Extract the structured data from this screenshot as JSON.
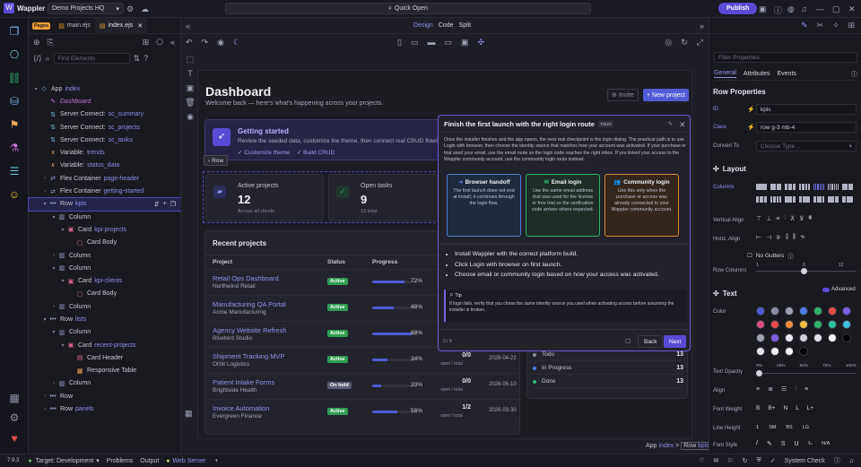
{
  "topbar": {
    "app_name": "Wappler",
    "project": "Demo Projects HQ",
    "quick_open": "Quick Open",
    "publish": "Publish"
  },
  "files": {
    "pages_badge": "Pages",
    "tabs": [
      {
        "label": "main.ejs"
      },
      {
        "label": "index.ejs"
      }
    ],
    "search_placeholder": "Find Elements"
  },
  "tree": [
    {
      "label": "App",
      "sub": "index",
      "indent": 0,
      "caret": "▾",
      "icon": "◇",
      "color": "#7fb8f0"
    },
    {
      "label": "Dashboard",
      "sub": "",
      "indent": 1,
      "caret": "",
      "icon": "✎",
      "color": "#c777d8",
      "italic": true
    },
    {
      "label": "Server Connect:",
      "sub": "sc_summary",
      "indent": 1,
      "caret": "",
      "icon": "⇅",
      "color": "#6ec0d8"
    },
    {
      "label": "Server Connect:",
      "sub": "sc_projects",
      "indent": 1,
      "caret": "",
      "icon": "⇅",
      "color": "#6ec0d8"
    },
    {
      "label": "Server Connect:",
      "sub": "sc_tasks",
      "indent": 1,
      "caret": "",
      "icon": "⇅",
      "color": "#6ec0d8"
    },
    {
      "label": "Variable:",
      "sub": "trends",
      "indent": 1,
      "caret": "",
      "icon": "𝑥",
      "color": "#f0a65a"
    },
    {
      "label": "Variable:",
      "sub": "status_data",
      "indent": 1,
      "caret": "",
      "icon": "𝑥",
      "color": "#f0a65a"
    },
    {
      "label": "Flex Container",
      "sub": "page-header",
      "indent": 1,
      "caret": "›",
      "icon": "⇄",
      "color": "#8fa3d8"
    },
    {
      "label": "Flex Container",
      "sub": "getting-started",
      "indent": 1,
      "caret": "›",
      "icon": "⇄",
      "color": "#8fa3d8"
    },
    {
      "label": "Row",
      "sub": "kpis",
      "indent": 1,
      "caret": "▾",
      "icon": "•••",
      "color": "#9aa0c8",
      "selected": true
    },
    {
      "label": "Column",
      "sub": "",
      "indent": 2,
      "caret": "▾",
      "icon": "▥",
      "color": "#9aa0c8"
    },
    {
      "label": "Card",
      "sub": "kpi-projects",
      "indent": 3,
      "caret": "▾",
      "icon": "▣",
      "color": "#d86a8a"
    },
    {
      "label": "Card Body",
      "sub": "",
      "indent": 4,
      "caret": "",
      "icon": "▢",
      "color": "#d86a8a"
    },
    {
      "label": "Column",
      "sub": "",
      "indent": 2,
      "caret": "›",
      "icon": "▥",
      "color": "#9aa0c8"
    },
    {
      "label": "Column",
      "sub": "",
      "indent": 2,
      "caret": "▾",
      "icon": "▥",
      "color": "#9aa0c8"
    },
    {
      "label": "Card",
      "sub": "kpi-clients",
      "indent": 3,
      "caret": "▾",
      "icon": "▣",
      "color": "#d86a8a"
    },
    {
      "label": "Card Body",
      "sub": "",
      "indent": 4,
      "caret": "",
      "icon": "▢",
      "color": "#d86a8a"
    },
    {
      "label": "Column",
      "sub": "",
      "indent": 2,
      "caret": "›",
      "icon": "▥",
      "color": "#9aa0c8"
    },
    {
      "label": "Row",
      "sub": "lists",
      "indent": 1,
      "caret": "▾",
      "icon": "•••",
      "color": "#9aa0c8"
    },
    {
      "label": "Column",
      "sub": "",
      "indent": 2,
      "caret": "▾",
      "icon": "▥",
      "color": "#9aa0c8"
    },
    {
      "label": "Card",
      "sub": "recent-projects",
      "indent": 3,
      "caret": "▾",
      "icon": "▣",
      "color": "#d86a8a"
    },
    {
      "label": "Card Header",
      "sub": "",
      "indent": 4,
      "caret": "",
      "icon": "▤",
      "color": "#d86a8a"
    },
    {
      "label": "Responsive Table",
      "sub": "",
      "indent": 4,
      "caret": "",
      "icon": "▦",
      "color": "#f0a65a"
    },
    {
      "label": "Column",
      "sub": "",
      "indent": 2,
      "caret": "›",
      "icon": "▥",
      "color": "#9aa0c8"
    },
    {
      "label": "Row",
      "sub": "",
      "indent": 1,
      "caret": "›",
      "icon": "•••",
      "color": "#9aa0c8"
    },
    {
      "label": "Row",
      "sub": "panels",
      "indent": 1,
      "caret": "›",
      "icon": "•••",
      "color": "#9aa0c8"
    }
  ],
  "view": {
    "modes": [
      "Design",
      "Code",
      "Split"
    ]
  },
  "page": {
    "title": "Dashboard",
    "subtitle": "Welcome back — here's what's happening across your projects.",
    "invite": "Invite",
    "new_project": "+ New project",
    "getting_started": {
      "title": "Getting started",
      "text": "Review the seeded data, customize the theme, then connect real CRUD flows.",
      "link1": "Customize theme",
      "link2": "Build CRUD"
    },
    "row_badge": "Row",
    "kpis": [
      {
        "label": "Active projects",
        "value": "12",
        "note": "Across all clients"
      },
      {
        "label": "Open tasks",
        "value": "9",
        "note": "13 total"
      }
    ],
    "recent": {
      "title": "Recent projects",
      "headers": [
        "Project",
        "Status",
        "Progress"
      ],
      "rows": [
        {
          "name": "Retail Ops Dashboard",
          "client": "Northwind Retail",
          "status": "Active",
          "progress": 72,
          "pct": "72%",
          "tasks": "",
          "sub": "",
          "date": ""
        },
        {
          "name": "Manufacturing QA Portal",
          "client": "Acme Manufacturing",
          "status": "Active",
          "progress": 48,
          "pct": "48%",
          "tasks": "",
          "sub": "",
          "date": ""
        },
        {
          "name": "Agency Website Refresh",
          "client": "Bluebird Studio",
          "status": "Active",
          "progress": 88,
          "pct": "88%",
          "tasks": "",
          "sub": "",
          "date": ""
        },
        {
          "name": "Shipment Tracking MVP",
          "client": "Orbit Logistics",
          "status": "Active",
          "progress": 34,
          "pct": "34%",
          "tasks": "0/0",
          "sub": "open / total",
          "date": "2026-04-22"
        },
        {
          "name": "Patient Intake Forms",
          "client": "Brightside Health",
          "status": "On hold",
          "progress": 20,
          "pct": "20%",
          "tasks": "0/0",
          "sub": "open / total",
          "date": "2026-05-10"
        },
        {
          "name": "Invoice Automation",
          "client": "Evergreen Finance",
          "status": "Active",
          "progress": 56,
          "pct": "56%",
          "tasks": "1/2",
          "sub": "open / total",
          "date": "2026-03-30"
        }
      ]
    },
    "task_status": [
      {
        "label": "Todo",
        "count": "13",
        "color": "#8b8fa3"
      },
      {
        "label": "In Progress",
        "count": "13",
        "color": "#4f7ee8"
      },
      {
        "label": "Done",
        "count": "13",
        "color": "#2fb36a"
      }
    ],
    "breadcrumb": {
      "app": "App",
      "app_sub": "index",
      "sep": ">",
      "row": "Row",
      "row_sub": "kpis"
    }
  },
  "tour": {
    "title": "Finish the first launch with the right login route",
    "badge": "TOUR",
    "intro": "Once the installer finishes and the app opens, the next real checkpoint is the login dialog. The practical path is to use Login with browser, then choose the identity source that matches how your account was activated. If your purchase or trial used your email, use the email route so the login code reaches the right inbox. If you linked your access to the Wappler community account, use the community login route instead.",
    "options": [
      {
        "title": "Browser handoff",
        "text": "The first launch does not end at install; it continues through the login flow.",
        "color": "#4d7fd8",
        "bg": "#1e2a3e",
        "icon": "⇥"
      },
      {
        "title": "Email login",
        "text": "Use the same email address that was used for the license or free trial so the verification code arrives where expected.",
        "color": "#2fb36a",
        "bg": "#1c2e26",
        "icon": "✉"
      },
      {
        "title": "Community login",
        "text": "Use this only when the purchase or access was already connected to your Wappler community account.",
        "color": "#d88a3a",
        "bg": "#33261c",
        "icon": "👥"
      }
    ],
    "steps": [
      "Install Wappler with the correct platform build.",
      "Click Login with browser on first launch.",
      "Choose email or community login based on how your access was activated."
    ],
    "tip_label": "Tip",
    "tip": "If login fails, verify that you chose the same identity source you used when activating access before assuming the installer is broken.",
    "counter": "3 / 4",
    "back": "Back",
    "next": "Next"
  },
  "right": {
    "search_placeholder": "Filter Properties",
    "tabs": [
      "General",
      "Attributes",
      "Events"
    ],
    "row_props": "Row Properties",
    "id_label": "ID",
    "id": "kpis",
    "class_label": "Class",
    "class": "row g-3 mb-4",
    "convert_label": "Convert To",
    "convert_placeholder": "Choose Type ..",
    "layout": "Layout",
    "columns_label": "Columns",
    "valign": "Vertical Align",
    "halign": "Horiz. Align",
    "no_gutters": "No Gutters",
    "row_columns": "Row Columns",
    "rc_min": "1",
    "rc_mid": "6",
    "rc_max": "12",
    "text": "Text",
    "advanced": "Advanced",
    "color_label": "Color",
    "opacity_label": "Text Opacity",
    "opacity_ticks": [
      "0%",
      "25%",
      "50%",
      "75%",
      "100%"
    ],
    "align_label": "Align",
    "weight_label": "Font Weight",
    "weights": [
      "B",
      "B+",
      "N",
      "L",
      "L+"
    ],
    "lh_label": "Line Height",
    "lh": [
      "1",
      "SM",
      "BS",
      "LG"
    ],
    "style_label": "Font Style",
    "style_na": "N/A",
    "swatches": [
      "#4f5bd5",
      "#8b8fa3",
      "#9aa0b0",
      "#4f7ee8",
      "#2fb36a",
      "#e84a4a",
      "#7c5ce0",
      "#d8507e",
      "#e84a4a",
      "#f08a3a",
      "#f0c040",
      "#2fb36a",
      "#30c0a0",
      "#40c0e0",
      "#a0a4b0",
      "#7c5ce0",
      "#e8e8ee",
      "#d0d0d8",
      "#e0e0e6",
      "#ffffff",
      "#000000",
      "#e0e0e8",
      "#f0f0f4",
      "#ffffff",
      "#000000"
    ]
  },
  "bottom": {
    "version": "7.9.3",
    "target": "Target: Development",
    "problems": "Problems",
    "output": "Output",
    "web_server": "Web Server",
    "system_check": "System Check"
  }
}
